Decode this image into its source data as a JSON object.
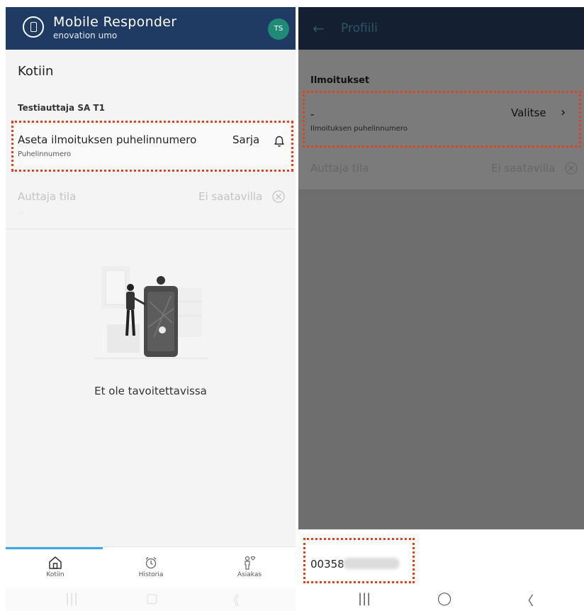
{
  "left": {
    "header": {
      "brand_title": "Mobile Responder",
      "brand_sub": "enovation umo",
      "avatar_initials": "TS"
    },
    "page_title": "Kotiin",
    "section_title": "Testiauttaja SA T1",
    "row_notification": {
      "title": "Aseta ilmoituksen puhelinnumero",
      "subtitle": "Puhelinnumero",
      "value": "Sarja",
      "icon": "bell-icon"
    },
    "row_status": {
      "title": "Auttaja tila",
      "subtitle": "...",
      "value": "Ei saatavilla",
      "icon": "close-circle-icon"
    },
    "empty_text": "Et ole tavoitettavissa",
    "bottom_nav": [
      {
        "label": "Kotiin",
        "icon": "home-icon"
      },
      {
        "label": "Historia",
        "icon": "alarm-clock-icon"
      },
      {
        "label": "Asiakas",
        "icon": "person-heart-icon"
      }
    ],
    "system_nav": {
      "recent": "|||",
      "home": "▢",
      "back": "《"
    }
  },
  "right": {
    "header": {
      "back": "←",
      "title": "Profiili"
    },
    "section_title": "Ilmoitukset",
    "row_notification": {
      "title": "-",
      "subtitle": "Ilmoituksen puhelinnumero",
      "value": "Valitse",
      "chevron": "›"
    },
    "row_status": {
      "title": "Auttaja tila",
      "value": "Ei saatavilla",
      "icon": "close-circle-icon"
    },
    "phone_input": {
      "value": "00358"
    },
    "system_nav": {
      "recent": "|||",
      "home": "◯",
      "back": "〈"
    }
  },
  "colors": {
    "header_left": "#1f3a63",
    "header_right": "#142032",
    "avatar": "#1f8a76",
    "highlight_dots": "#e4411b",
    "nav_indicator": "#3aa9e3"
  }
}
